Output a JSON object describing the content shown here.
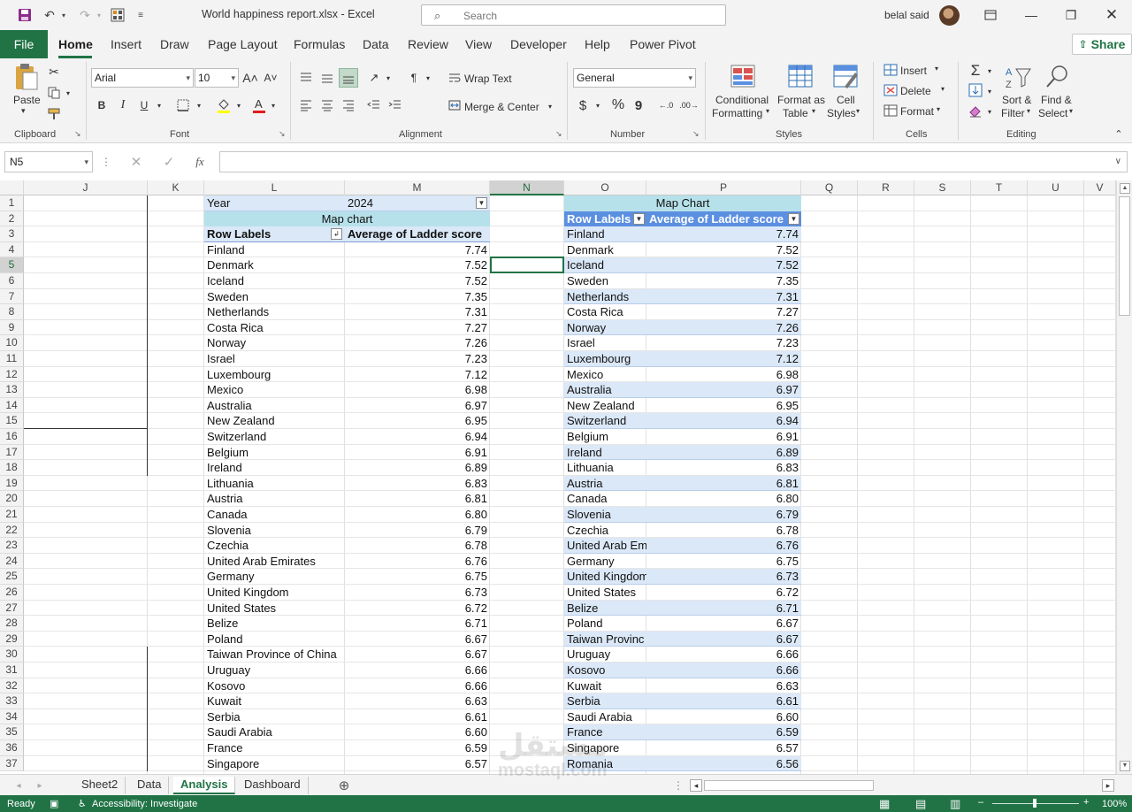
{
  "titlebar": {
    "doc_title": "World happiness report.xlsx  -  Excel",
    "search_placeholder": "Search",
    "user_name": "belal said"
  },
  "ribbon_tabs": [
    "File",
    "Home",
    "Insert",
    "Draw",
    "Page Layout",
    "Formulas",
    "Data",
    "Review",
    "View",
    "Developer",
    "Help",
    "Power Pivot"
  ],
  "active_tab": "Home",
  "share_label": "Share",
  "ribbon": {
    "clipboard": {
      "paste": "Paste",
      "label": "Clipboard"
    },
    "font": {
      "name": "Arial",
      "size": "10",
      "label": "Font",
      "bold": "B",
      "italic": "I",
      "underline": "U"
    },
    "alignment": {
      "wrap_text": "Wrap Text",
      "merge_center": "Merge & Center",
      "label": "Alignment"
    },
    "number": {
      "format": "General",
      "label": "Number",
      "currency": "$",
      "percent": "%",
      "comma": "9"
    },
    "styles": {
      "conditional": [
        "Conditional",
        "Formatting"
      ],
      "format_table": [
        "Format as",
        "Table"
      ],
      "cell_styles": [
        "Cell",
        "Styles"
      ],
      "label": "Styles"
    },
    "cells": {
      "insert": "Insert",
      "delete": "Delete",
      "format": "Format",
      "label": "Cells"
    },
    "editing": {
      "sort_filter": [
        "Sort &",
        "Filter"
      ],
      "find_select": [
        "Find &",
        "Select"
      ],
      "label": "Editing"
    }
  },
  "formula_bar": {
    "name_box": "N5",
    "fx": "fx",
    "value": ""
  },
  "columns": [
    "J",
    "K",
    "L",
    "M",
    "N",
    "O",
    "P",
    "Q",
    "R",
    "S",
    "T",
    "U",
    "V"
  ],
  "selected_column": "N",
  "rows": [
    1,
    2,
    3,
    4,
    5,
    6,
    7,
    8,
    9,
    10,
    11,
    12,
    13,
    14,
    15,
    16,
    17,
    18,
    19,
    20,
    21,
    22,
    23,
    24,
    25,
    26,
    27,
    28,
    29,
    30,
    31,
    32,
    33,
    34,
    35,
    36,
    37
  ],
  "selected_row": 5,
  "pivot1": {
    "year_label": "Year",
    "year_value": "2024",
    "title": "Map chart",
    "row_labels_header": "Row Labels",
    "value_header": "Average of Ladder score",
    "rows": [
      [
        "Finland",
        "7.74"
      ],
      [
        "Denmark",
        "7.52"
      ],
      [
        "Iceland",
        "7.52"
      ],
      [
        "Sweden",
        "7.35"
      ],
      [
        "Netherlands",
        "7.31"
      ],
      [
        "Costa Rica",
        "7.27"
      ],
      [
        "Norway",
        "7.26"
      ],
      [
        "Israel",
        "7.23"
      ],
      [
        "Luxembourg",
        "7.12"
      ],
      [
        "Mexico",
        "6.98"
      ],
      [
        "Australia",
        "6.97"
      ],
      [
        "New Zealand",
        "6.95"
      ],
      [
        "Switzerland",
        "6.94"
      ],
      [
        "Belgium",
        "6.91"
      ],
      [
        "Ireland",
        "6.89"
      ],
      [
        "Lithuania",
        "6.83"
      ],
      [
        "Austria",
        "6.81"
      ],
      [
        "Canada",
        "6.80"
      ],
      [
        "Slovenia",
        "6.79"
      ],
      [
        "Czechia",
        "6.78"
      ],
      [
        "United Arab Emirates",
        "6.76"
      ],
      [
        "Germany",
        "6.75"
      ],
      [
        "United Kingdom",
        "6.73"
      ],
      [
        "United States",
        "6.72"
      ],
      [
        "Belize",
        "6.71"
      ],
      [
        "Poland",
        "6.67"
      ],
      [
        "Taiwan Province of China",
        "6.67"
      ],
      [
        "Uruguay",
        "6.66"
      ],
      [
        "Kosovo",
        "6.66"
      ],
      [
        "Kuwait",
        "6.63"
      ],
      [
        "Serbia",
        "6.61"
      ],
      [
        "Saudi Arabia",
        "6.60"
      ],
      [
        "France",
        "6.59"
      ],
      [
        "Singapore",
        "6.57"
      ]
    ]
  },
  "pivot2": {
    "title": "Map Chart",
    "row_labels_header": "Row Labels",
    "value_header": "Average of Ladder score",
    "rows": [
      [
        "Finland",
        "7.74"
      ],
      [
        "Denmark",
        "7.52"
      ],
      [
        "Iceland",
        "7.52"
      ],
      [
        "Sweden",
        "7.35"
      ],
      [
        "Netherlands",
        "7.31"
      ],
      [
        "Costa Rica",
        "7.27"
      ],
      [
        "Norway",
        "7.26"
      ],
      [
        "Israel",
        "7.23"
      ],
      [
        "Luxembourg",
        "7.12"
      ],
      [
        "Mexico",
        "6.98"
      ],
      [
        "Australia",
        "6.97"
      ],
      [
        "New Zealand",
        "6.95"
      ],
      [
        "Switzerland",
        "6.94"
      ],
      [
        "Belgium",
        "6.91"
      ],
      [
        "Ireland",
        "6.89"
      ],
      [
        "Lithuania",
        "6.83"
      ],
      [
        "Austria",
        "6.81"
      ],
      [
        "Canada",
        "6.80"
      ],
      [
        "Slovenia",
        "6.79"
      ],
      [
        "Czechia",
        "6.78"
      ],
      [
        "United Arab Em",
        "6.76"
      ],
      [
        "Germany",
        "6.75"
      ],
      [
        "United Kingdom",
        "6.73"
      ],
      [
        "United States",
        "6.72"
      ],
      [
        "Belize",
        "6.71"
      ],
      [
        "Poland",
        "6.67"
      ],
      [
        "Taiwan Provinc",
        "6.67"
      ],
      [
        "Uruguay",
        "6.66"
      ],
      [
        "Kosovo",
        "6.66"
      ],
      [
        "Kuwait",
        "6.63"
      ],
      [
        "Serbia",
        "6.61"
      ],
      [
        "Saudi Arabia",
        "6.60"
      ],
      [
        "France",
        "6.59"
      ],
      [
        "Singapore",
        "6.57"
      ],
      [
        "Romania",
        "6.56"
      ]
    ]
  },
  "sheets": [
    "Sheet2",
    "Data",
    "Analysis",
    "Dashboard"
  ],
  "active_sheet": "Analysis",
  "statusbar": {
    "ready": "Ready",
    "accessibility": "Accessibility: Investigate",
    "zoom": "100%"
  },
  "watermark": {
    "arabic": "مستقل",
    "latin": "mostaql.com"
  },
  "colors": {
    "excel_green": "#217346",
    "band_blue": "#dbe8f8",
    "header_teal": "#b7e1ea",
    "header_blue": "#5b8fe0"
  }
}
